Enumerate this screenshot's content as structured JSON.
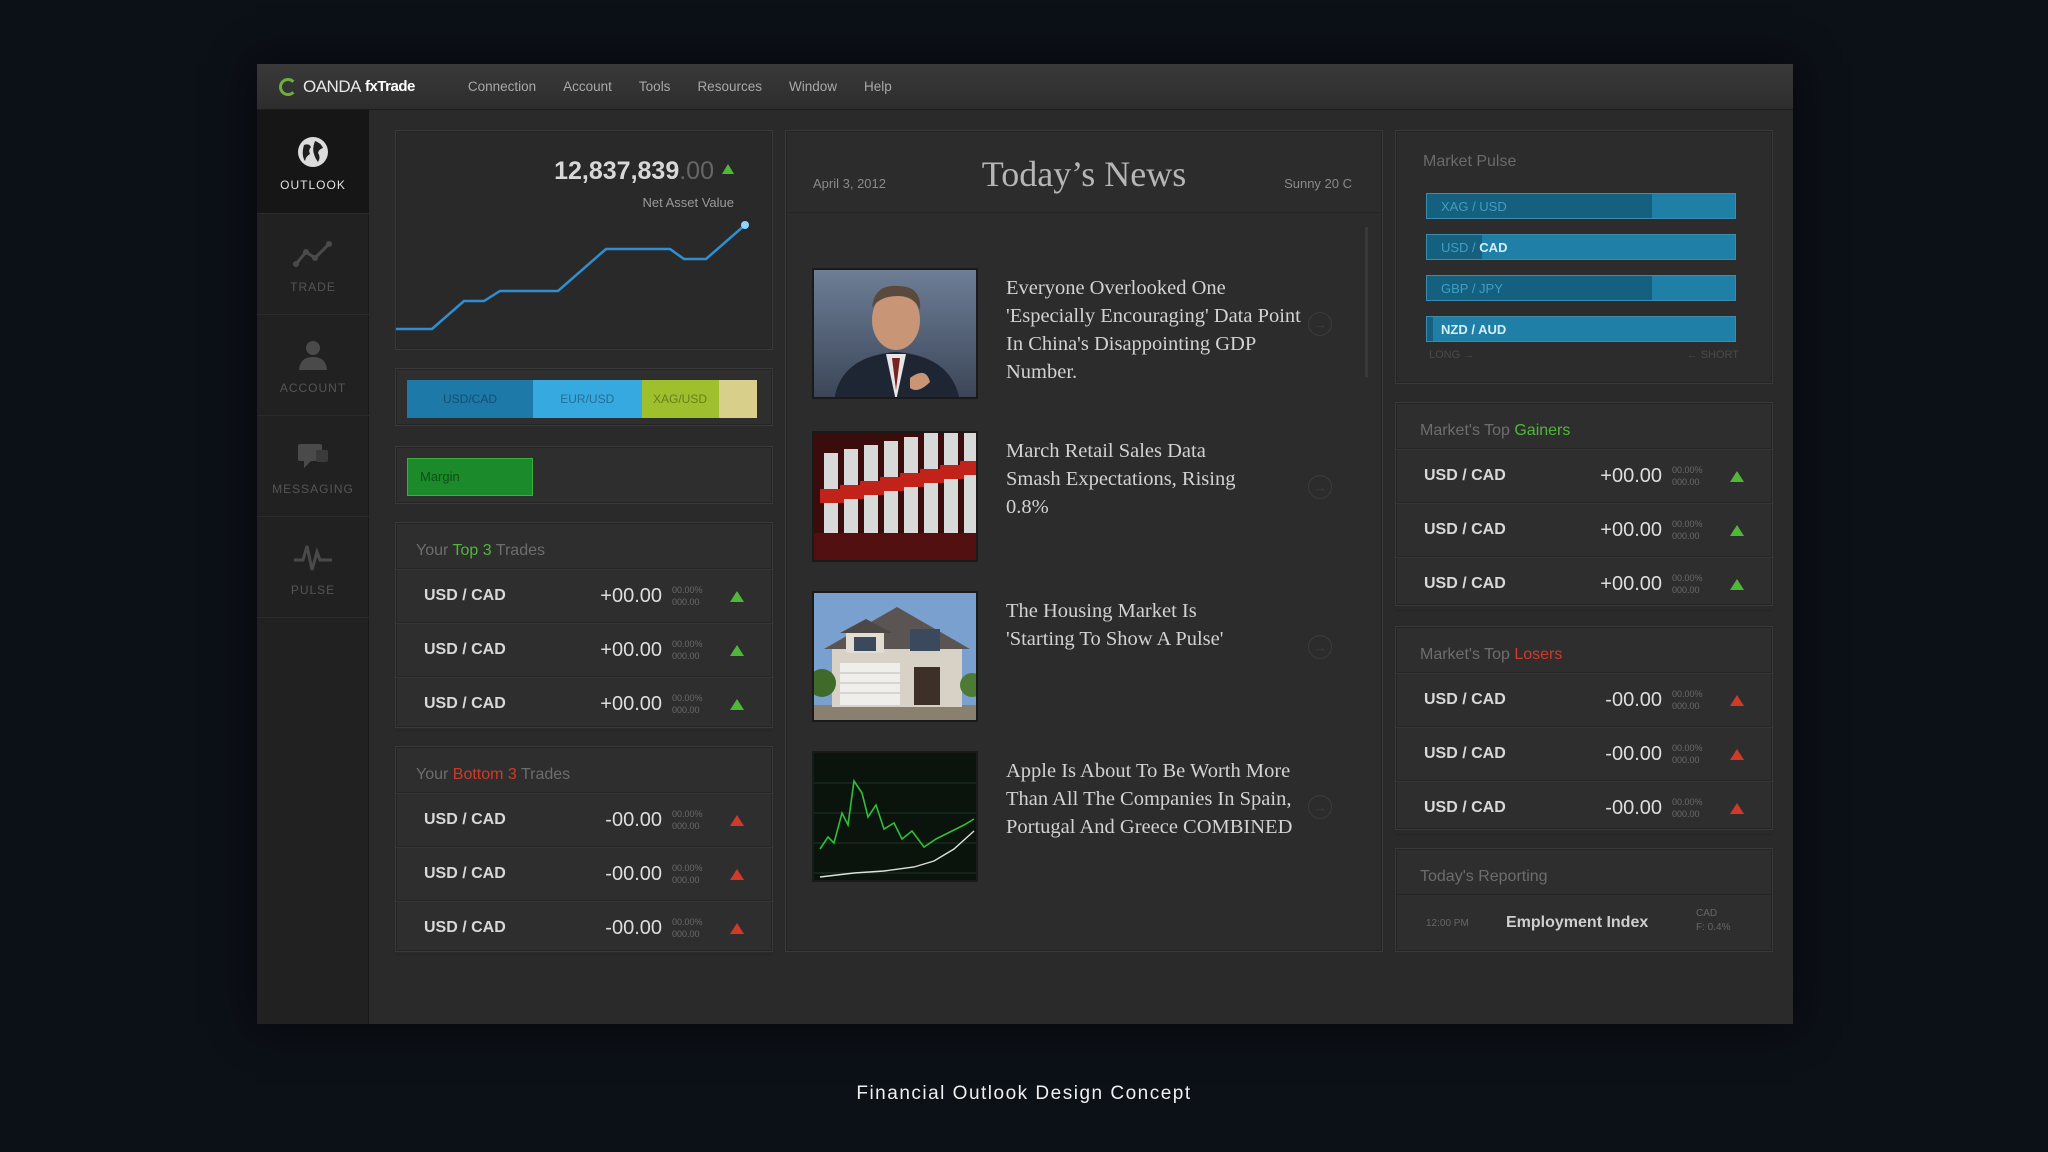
{
  "menubar": {
    "logo_brand": "OANDA",
    "logo_product": "fxTrade",
    "items": [
      "Connection",
      "Account",
      "Tools",
      "Resources",
      "Window",
      "Help"
    ]
  },
  "sidebar": {
    "items": [
      {
        "label": "OUTLOOK",
        "icon": "globe-icon"
      },
      {
        "label": "TRADE",
        "icon": "line-chart-icon"
      },
      {
        "label": "ACCOUNT",
        "icon": "user-icon"
      },
      {
        "label": "MESSAGING",
        "icon": "chat-bubble-icon"
      },
      {
        "label": "PULSE",
        "icon": "pulse-icon"
      }
    ]
  },
  "asset": {
    "value_main": "12,837,839",
    "value_cents": ".00",
    "label": "Net Asset Value",
    "trend_color": "#2f8fd1"
  },
  "allocation": {
    "segments": [
      {
        "label": "USD/CAD",
        "share": 0.36,
        "color": "#1d79a8"
      },
      {
        "label": "EUR/USD",
        "share": 0.31,
        "color": "#36a9e1"
      },
      {
        "label": "XAG/USD",
        "share": 0.22,
        "color": "#9fbf2c"
      },
      {
        "label": "",
        "share": 0.11,
        "color": "#d8cf8a"
      }
    ]
  },
  "margin": {
    "label": "Margin",
    "level": 0.36
  },
  "top_trades": {
    "head_pre": "Your ",
    "head_hl": "Top 3",
    "head_post": " Trades",
    "rows": [
      {
        "pair": "USD / CAD",
        "value": "+00.00",
        "pct": "00.00%",
        "sub": "000.00"
      },
      {
        "pair": "USD / CAD",
        "value": "+00.00",
        "pct": "00.00%",
        "sub": "000.00"
      },
      {
        "pair": "USD / CAD",
        "value": "+00.00",
        "pct": "00.00%",
        "sub": "000.00"
      }
    ]
  },
  "bottom_trades": {
    "head_pre": "Your ",
    "head_hl": "Bottom 3",
    "head_post": " Trades",
    "rows": [
      {
        "pair": "USD / CAD",
        "value": "-00.00",
        "pct": "00.00%",
        "sub": "000.00"
      },
      {
        "pair": "USD / CAD",
        "value": "-00.00",
        "pct": "00.00%",
        "sub": "000.00"
      },
      {
        "pair": "USD / CAD",
        "value": "-00.00",
        "pct": "00.00%",
        "sub": "000.00"
      }
    ]
  },
  "news": {
    "date": "April 3, 2012",
    "title": "Today’s News",
    "weather": "Sunny 20 C",
    "items": [
      {
        "headline": "Everyone Overlooked One 'Especially Encouraging' Data Point In China's Disappointing GDP Number.",
        "thumb": "portrait"
      },
      {
        "headline": "March Retail Sales Data Smash Expectations, Rising 0.8%",
        "thumb": "carts"
      },
      {
        "headline": "The Housing Market Is 'Starting To Show A Pulse'",
        "thumb": "house"
      },
      {
        "headline": "Apple Is About To Be Worth More Than All The Companies In Spain, Portugal And Greece COMBINED",
        "thumb": "chart"
      }
    ]
  },
  "market_pulse": {
    "title": "Market Pulse",
    "long_label": "LONG",
    "short_label": "SHORT",
    "bars": [
      {
        "base": "XAG / USD",
        "quote": "",
        "long": 0.73
      },
      {
        "base": "USD / ",
        "quote": "CAD",
        "long": 0.18
      },
      {
        "base": "GBP / JPY",
        "quote": "",
        "long": 0.73
      },
      {
        "base": "",
        "quote": "NZD / AUD",
        "long": 0.02
      }
    ]
  },
  "gainers": {
    "head_pre": "Market's Top ",
    "head_hl": "Gainers",
    "rows": [
      {
        "pair": "USD / CAD",
        "value": "+00.00",
        "pct": "00.00%",
        "sub": "000.00"
      },
      {
        "pair": "USD / CAD",
        "value": "+00.00",
        "pct": "00.00%",
        "sub": "000.00"
      },
      {
        "pair": "USD / CAD",
        "value": "+00.00",
        "pct": "00.00%",
        "sub": "000.00"
      }
    ]
  },
  "losers": {
    "head_pre": "Market's Top ",
    "head_hl": "Losers",
    "rows": [
      {
        "pair": "USD / CAD",
        "value": "-00.00",
        "pct": "00.00%",
        "sub": "000.00"
      },
      {
        "pair": "USD / CAD",
        "value": "-00.00",
        "pct": "00.00%",
        "sub": "000.00"
      },
      {
        "pair": "USD / CAD",
        "value": "-00.00",
        "pct": "00.00%",
        "sub": "000.00"
      }
    ]
  },
  "reporting": {
    "title": "Today's Reporting",
    "time": "12:00 PM",
    "event": "Employment Index",
    "currency": "CAD",
    "forecast": "F: 0.4%"
  },
  "caption": "Financial Outlook Design Concept"
}
